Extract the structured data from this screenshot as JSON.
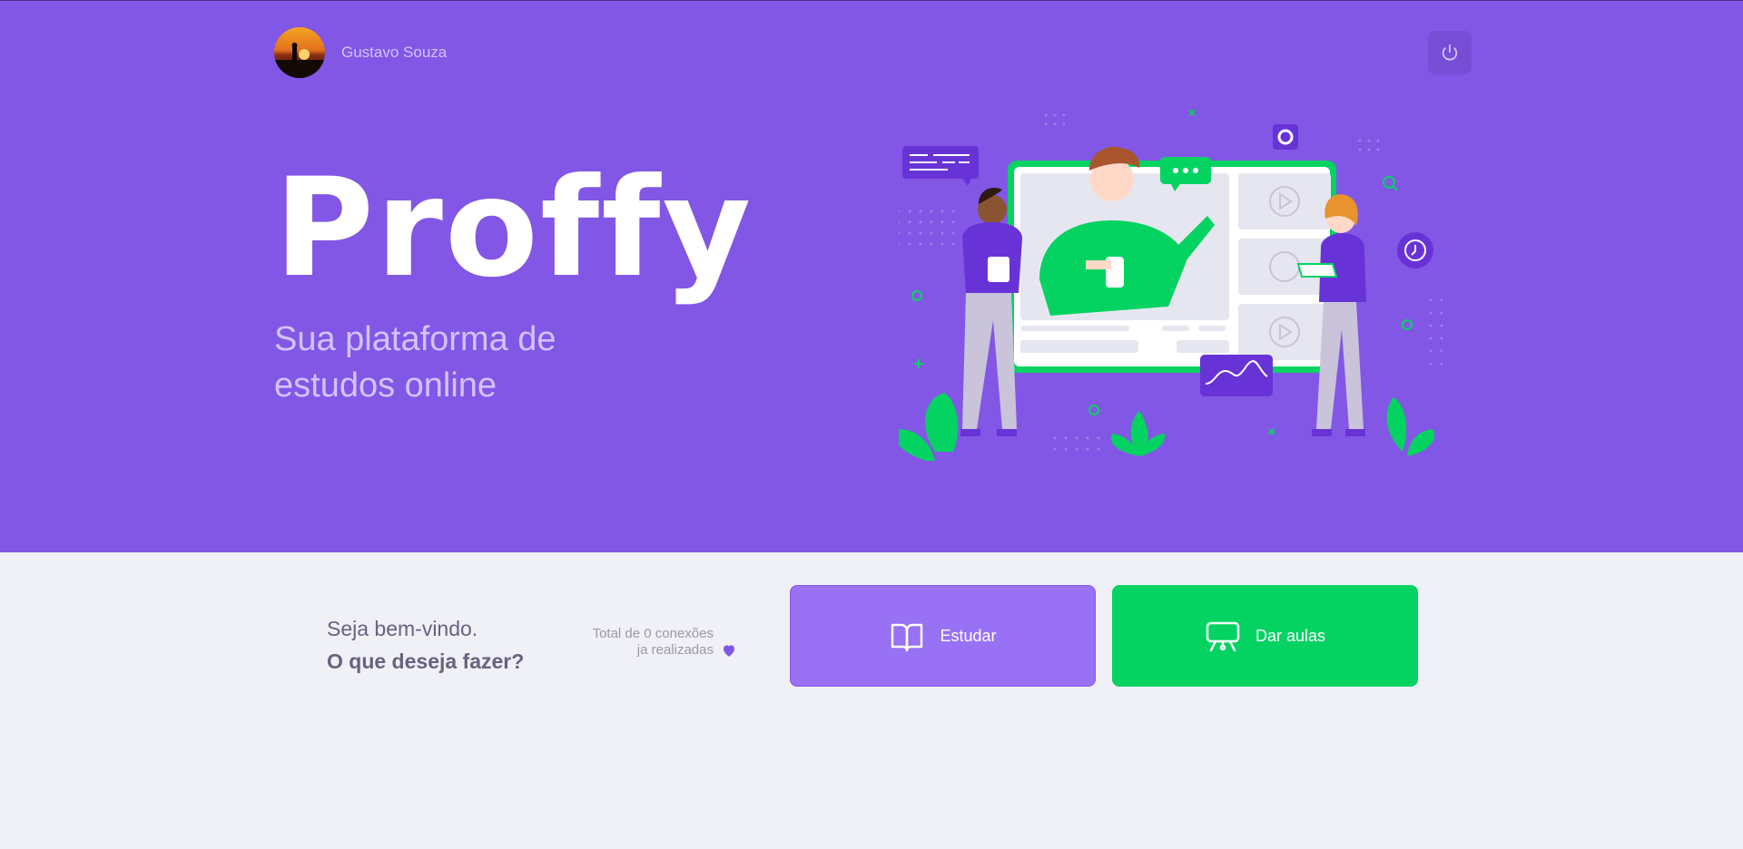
{
  "user": {
    "name": "Gustavo Souza"
  },
  "logo": {
    "text": "Proffy"
  },
  "tagline": {
    "line1": "Sua plataforma de",
    "line2": "estudos online"
  },
  "welcome": {
    "line1": "Seja bem-vindo.",
    "line2": "O que deseja fazer?"
  },
  "connections": {
    "line1": "Total de 0 conexões",
    "line2": "ja realizadas"
  },
  "buttons": {
    "study": "Estudar",
    "teach": "Dar aulas"
  },
  "colors": {
    "primary": "#8257E5",
    "primary_light": "#9871F5",
    "secondary": "#04D361",
    "background": "#F0F0F7",
    "text_title": "#6A6180",
    "text_muted": "#9C98A6"
  },
  "icons": {
    "logout": "power-icon",
    "study": "book-open-icon",
    "teach": "presentation-icon",
    "heart": "heart-icon"
  }
}
